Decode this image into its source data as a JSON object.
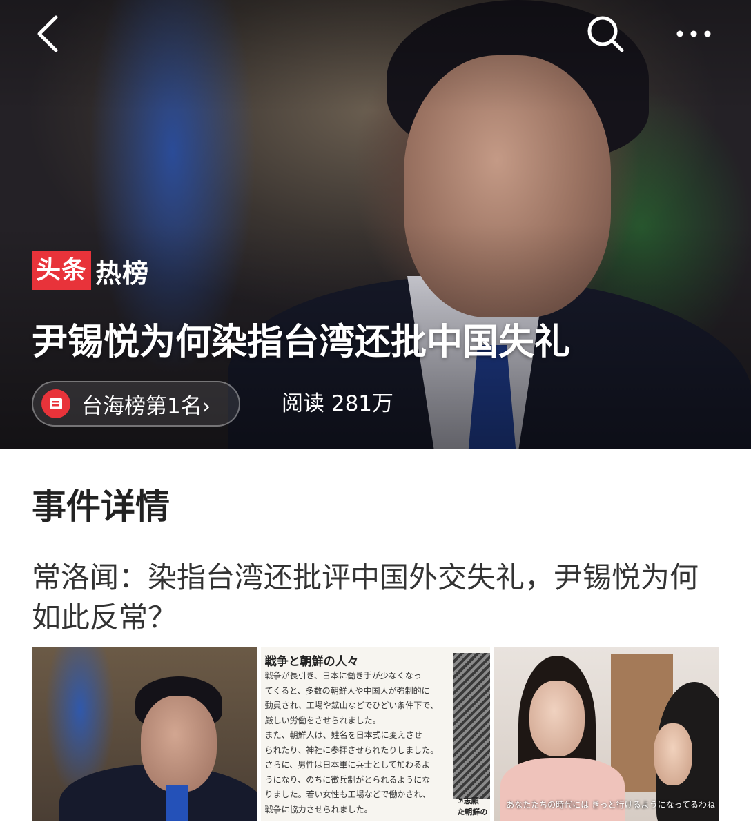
{
  "topbar": {
    "back_icon": "chevron-left-icon",
    "search_icon": "search-icon",
    "more_icon": "more-horizontal-icon"
  },
  "hero": {
    "brand_red": "头条",
    "brand_white": "热榜",
    "title": "尹锡悦为何染指台湾还批中国失礼",
    "rank_label": "台海榜第1名",
    "rank_chevron": "›",
    "read_count": "阅读 281万"
  },
  "details": {
    "section_title": "事件详情",
    "article_headline": "常洛闻：染指台湾还批评中国外交失礼，尹锡悦为何如此反常？"
  },
  "thumbnails": {
    "doc": {
      "title": "戦争と朝鮮の人々",
      "lines": [
        "戦争が長引き、日本に働き手が少なくなっ",
        "てくると、多数の朝鮮人や中国人が強制的に",
        "動員され、工場や鉱山などでひどい条件下で、",
        "厳しい労働をさせられました。",
        "また、朝鮮人は、姓名を日本式に変えさせ",
        "られたり、神社に参拝させられたりしました。",
        "さらに、男性は日本軍に兵士として加わるよ",
        "うになり、のちに徴兵制がとられるようにな",
        "りました。若い女性も工場などで働かされ、",
        "戦争に協力させられました。"
      ],
      "caption_1": "⑦志願",
      "caption_2": "た朝鮮の"
    },
    "video_subtitle": "あなたたちの時代には きっと行けるようになってるわね"
  },
  "colors": {
    "brand_red": "#e8333a",
    "hero_text": "#ffffff",
    "section_text": "#222222",
    "headline_text": "#333333"
  }
}
